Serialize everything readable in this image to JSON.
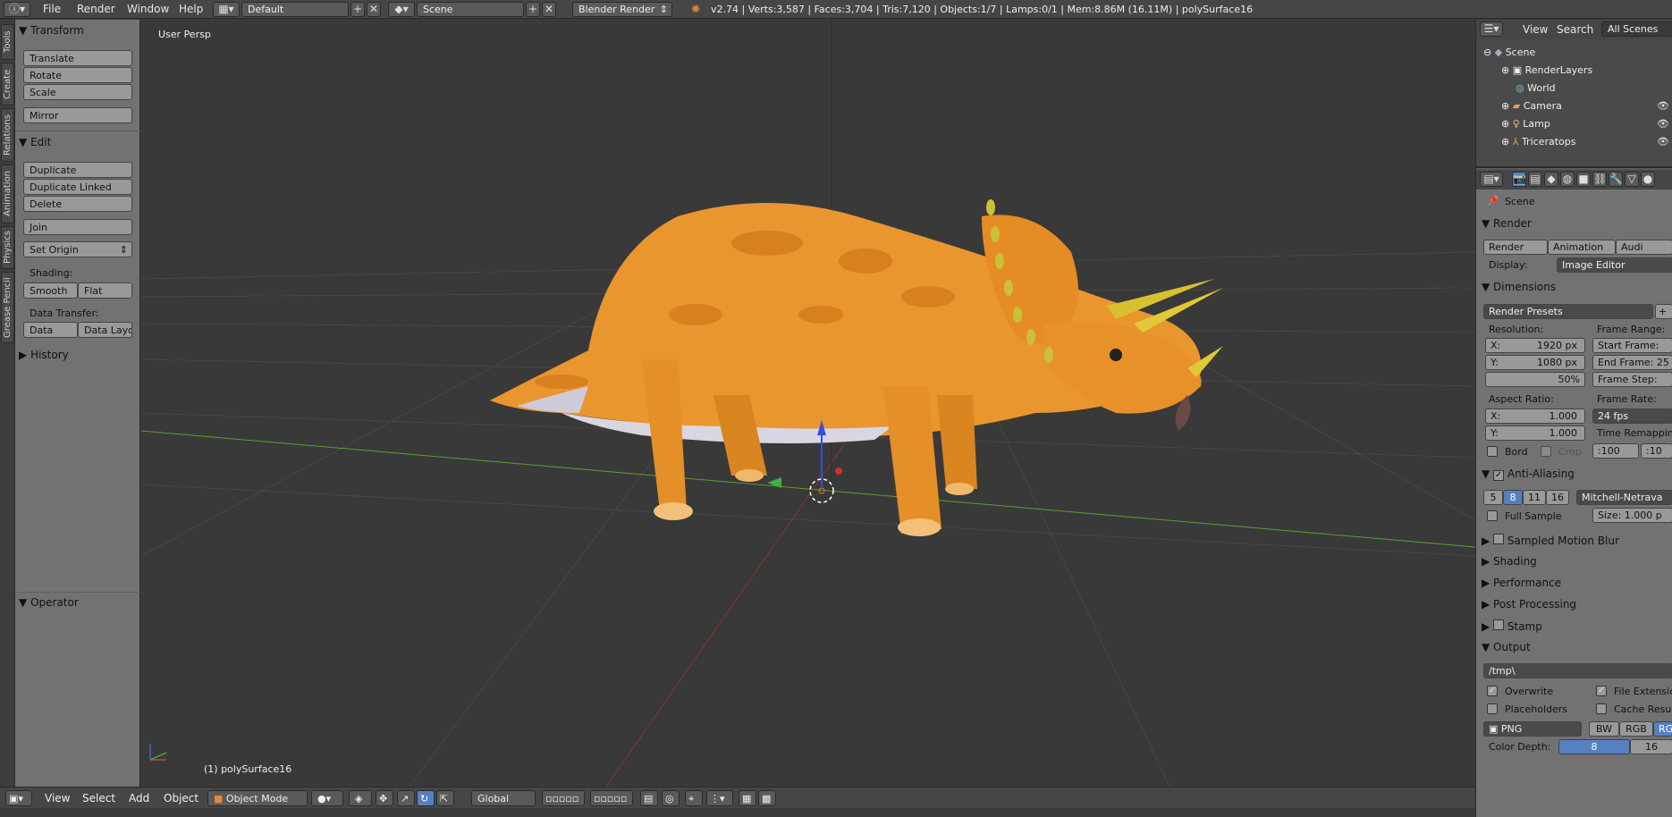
{
  "topbar": {
    "menus": [
      "File",
      "Render",
      "Window",
      "Help"
    ],
    "layout": "Default",
    "scene": "Scene",
    "engine": "Blender Render",
    "stats": "v2.74 | Verts:3,587 | Faces:3,704 | Tris:7,120 | Objects:1/7 | Lamps:0/1 | Mem:8.86M (16.11M) | polySurface16"
  },
  "vtabs": [
    "Tools",
    "Create",
    "Relations",
    "Animation",
    "Physics",
    "Grease Pencil"
  ],
  "toolshelf": {
    "transform_header": "Transform",
    "translate": "Translate",
    "rotate": "Rotate",
    "scale": "Scale",
    "mirror": "Mirror",
    "edit_header": "Edit",
    "duplicate": "Duplicate",
    "duplicate_linked": "Duplicate Linked",
    "delete": "Delete",
    "join": "Join",
    "set_origin": "Set Origin",
    "shading_label": "Shading:",
    "smooth": "Smooth",
    "flat": "Flat",
    "data_transfer_label": "Data Transfer:",
    "data": "Data",
    "data_layo": "Data Layo",
    "history_header": "History",
    "operator_header": "Operator"
  },
  "viewport": {
    "view_label": "User Persp",
    "object_label": "(1) polySurface16"
  },
  "bottombar": {
    "view": "View",
    "select": "Select",
    "add": "Add",
    "object": "Object",
    "mode": "Object Mode",
    "orientation": "Global"
  },
  "outliner": {
    "view": "View",
    "search": "Search",
    "all_scenes": "All Scenes",
    "items": [
      "Scene",
      "RenderLayers",
      "World",
      "Camera",
      "Lamp",
      "Triceratops"
    ]
  },
  "properties": {
    "scene": "Scene",
    "render_header": "Render",
    "render_btn": "Render",
    "animation_btn": "Animation",
    "audio_btn": "Audi",
    "display_label": "Display:",
    "display_value": "Image Editor",
    "dimensions_header": "Dimensions",
    "render_presets": "Render Presets",
    "resolution_label": "Resolution:",
    "res_x": "X:",
    "res_x_val": "1920 px",
    "res_y": "Y:",
    "res_y_val": "1080 px",
    "res_pct": "50%",
    "frame_range_label": "Frame Range:",
    "start_frame": "Start Frame:",
    "end_frame": "End Frame: 25",
    "frame_step": "Frame Step:",
    "aspect_label": "Aspect Ratio:",
    "asp_x": "X:",
    "asp_x_val": "1.000",
    "asp_y": "Y:",
    "asp_y_val": "1.000",
    "frame_rate_label": "Frame Rate:",
    "fps": "24 fps",
    "time_remap_label": "Time Remapping",
    "remap_a": ":100",
    "remap_b": ":10",
    "bord": "Bord",
    "crop": "Crop",
    "aa_header": "Anti-Aliasing",
    "aa_5": "5",
    "aa_8": "8",
    "aa_11": "11",
    "aa_16": "16",
    "aa_filter": "Mitchell-Netrava",
    "full_sample": "Full Sample",
    "aa_size": "Size:",
    "aa_size_val": "1.000 p",
    "motion_blur": "Sampled Motion Blur",
    "shading": "Shading",
    "performance": "Performance",
    "post_processing": "Post Processing",
    "stamp": "Stamp",
    "output_header": "Output",
    "output_path": "/tmp\\",
    "overwrite": "Overwrite",
    "file_extensions": "File Extensio",
    "placeholders": "Placeholders",
    "cache_result": "Cache Result",
    "format": "PNG",
    "bw": "BW",
    "rgb": "RGB",
    "rgba": "RG",
    "color_depth_label": "Color Depth:",
    "cd_8": "8",
    "cd_16": "16"
  }
}
